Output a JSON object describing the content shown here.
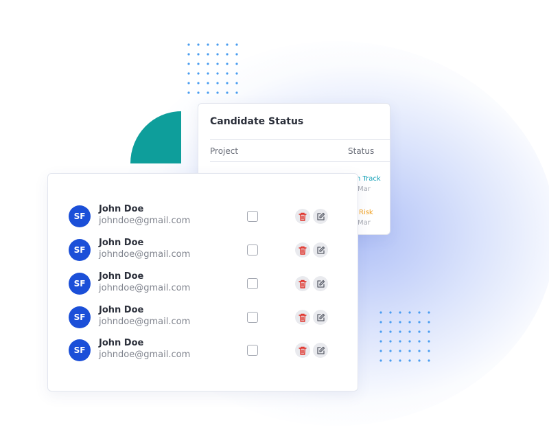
{
  "candidate_status": {
    "title": "Candidate Status",
    "columns": {
      "project": "Project",
      "status": "Status"
    },
    "rows": [
      {
        "status": "n Track",
        "status_color": "#17a2b8",
        "date": "Mar"
      },
      {
        "status": "Risk",
        "status_color": "#f0a020",
        "date": "Mar"
      }
    ]
  },
  "users": [
    {
      "initials": "SF",
      "name": "John Doe",
      "email": "johndoe@gmail.com"
    },
    {
      "initials": "SF",
      "name": "John Doe",
      "email": "johndoe@gmail.com"
    },
    {
      "initials": "SF",
      "name": "John Doe",
      "email": "johndoe@gmail.com"
    },
    {
      "initials": "SF",
      "name": "John Doe",
      "email": "johndoe@gmail.com"
    },
    {
      "initials": "SF",
      "name": "John Doe",
      "email": "johndoe@gmail.com"
    }
  ],
  "icons": {
    "delete": "trash-icon",
    "edit": "edit-icon"
  },
  "colors": {
    "avatar": "#1b4fd8",
    "accent_teal": "#0e9e9b",
    "delete_icon": "#e0322a",
    "dots": "#4a9df0"
  }
}
